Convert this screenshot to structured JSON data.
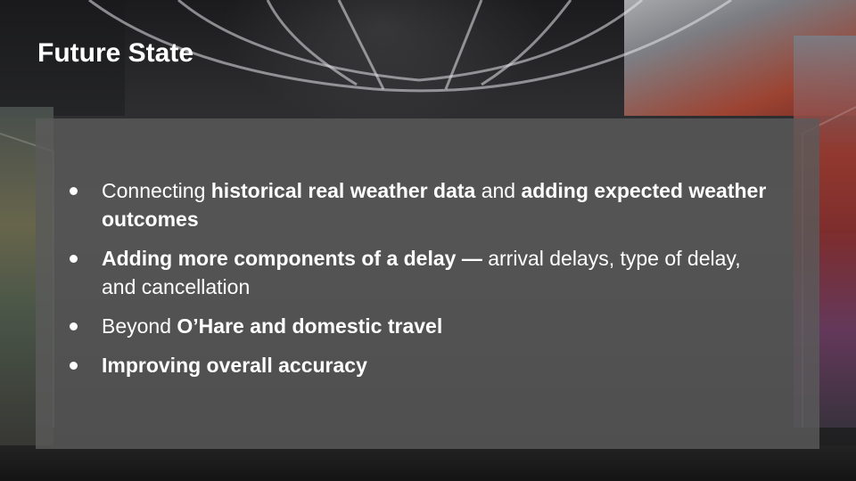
{
  "slide": {
    "title": "Future State",
    "colors": {
      "text": "#ffffff",
      "panel": "#5a5a5a",
      "background": "#2a2a2c"
    },
    "bullets": [
      {
        "parts": [
          {
            "text": "Connecting ",
            "bold": false
          },
          {
            "text": "historical real weather data",
            "bold": true
          },
          {
            "text": " and ",
            "bold": false
          },
          {
            "text": "adding expected weather outcomes",
            "bold": true
          }
        ]
      },
      {
        "parts": [
          {
            "text": "Adding more components of a delay —",
            "bold": true
          },
          {
            "text": " arrival delays, type of delay, and cancellation",
            "bold": false
          }
        ]
      },
      {
        "parts": [
          {
            "text": "Beyond ",
            "bold": false
          },
          {
            "text": "O’Hare and domestic travel",
            "bold": true
          }
        ]
      },
      {
        "parts": [
          {
            "text": "Improving overall accuracy",
            "bold": true
          }
        ]
      }
    ]
  }
}
